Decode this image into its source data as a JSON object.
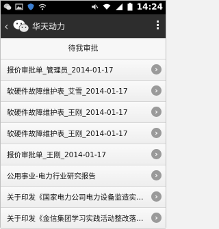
{
  "status_bar": {
    "time": "14:24",
    "left_icons": [
      "wechat-notification-icon",
      "image-icon",
      "shield-icon",
      "wifi-icon"
    ],
    "right_icons": [
      "mute-icon",
      "wifi-signal-icon",
      "cell-signal-icon",
      "battery-icon"
    ]
  },
  "title_bar": {
    "back_glyph": "‹",
    "title": "华天动力"
  },
  "list": {
    "header": "待我审批",
    "items": [
      {
        "label": "报价审批单_管理员_2014-01-17"
      },
      {
        "label": "软硬件故障维护表_艾雪_2014-01-17"
      },
      {
        "label": "软硬件故障维护表_王刚_2014-01-17"
      },
      {
        "label": "软硬件故障维护表_王刚_2014-01-17"
      },
      {
        "label": "报价审批单_王刚_2014-01-17"
      },
      {
        "label": "公用事业-电力行业研究报告"
      },
      {
        "label": "关于印发《国家电力公司电力设备监造实施..."
      },
      {
        "label": "关于印发《金信集团学习实践活动整改落实..."
      }
    ]
  },
  "colors": {
    "status_bar_bg": "#000000",
    "title_bar_bg": "#2d2d2d",
    "wechat_green": "#1fbf3a",
    "chevron_gray": "#9a9a9a"
  }
}
